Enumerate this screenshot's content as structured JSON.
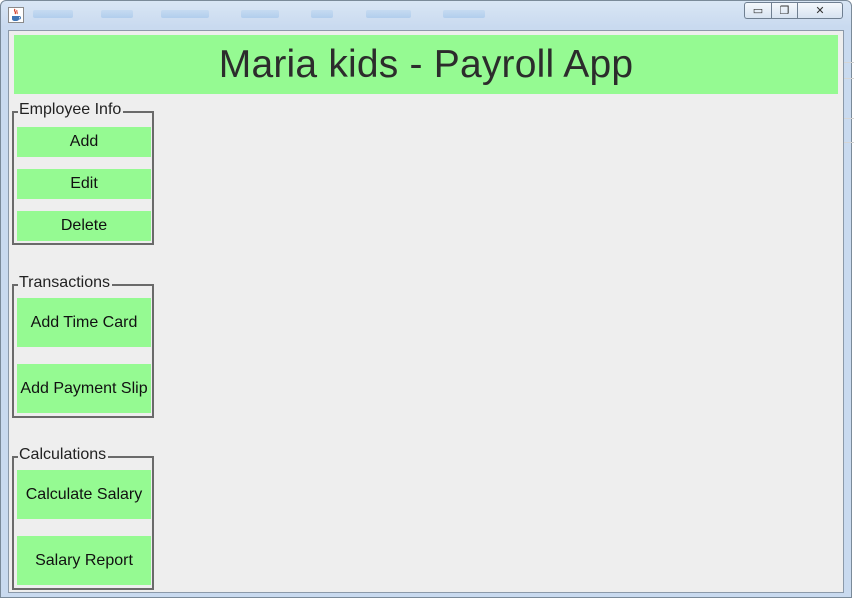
{
  "window": {
    "controls": {
      "minimize_icon": "minimize-icon",
      "maximize_icon": "maximize-icon",
      "close_icon": "close-icon",
      "minimize_glyph": "▭",
      "maximize_glyph": "❐",
      "close_glyph": "✕"
    }
  },
  "header": {
    "title": "Maria kids - Payroll App",
    "bg_color": "#95fa92"
  },
  "groups": {
    "employee": {
      "title": "Employee Info",
      "buttons": [
        "Add",
        "Edit",
        "Delete"
      ]
    },
    "transactions": {
      "title": "Transactions",
      "buttons": [
        "Add Time Card",
        "Add Payment Slip"
      ]
    },
    "calculations": {
      "title": "Calculations",
      "buttons": [
        "Calculate Salary",
        "Salary Report"
      ]
    }
  },
  "colors": {
    "accent_green": "#95fa92",
    "panel_bg": "#eeeeee",
    "border": "#6a6a6a"
  }
}
